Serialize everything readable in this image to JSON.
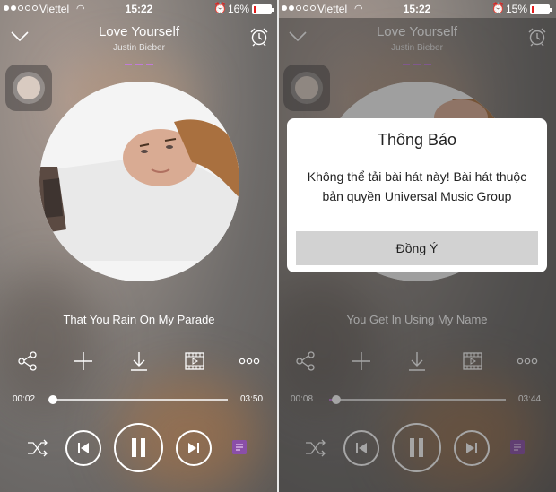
{
  "left": {
    "status": {
      "carrier": "Viettel",
      "time": "15:22",
      "battery": "16%",
      "battery_level": 0.16
    },
    "header": {
      "title": "Love Yourself",
      "artist": "Justin Bieber"
    },
    "now_playing": "That You Rain On My Parade",
    "player": {
      "elapsed": "00:02",
      "duration": "03:50",
      "progress": 0.01
    }
  },
  "right": {
    "status": {
      "carrier": "Viettel",
      "time": "15:22",
      "battery": "15%",
      "battery_level": 0.15
    },
    "header": {
      "title": "Love Yourself",
      "artist": "Justin Bieber"
    },
    "now_playing": "You Get In Using My Name",
    "player": {
      "elapsed": "00:08",
      "duration": "03:44",
      "progress": 0.04
    },
    "dialog": {
      "title": "Thông Báo",
      "message_line1": "Không thể tải bài hát này! Bài hát thuộc",
      "message_line2": "bản quyền Universal Music Group",
      "confirm_label": "Đồng Ý"
    }
  },
  "colors": {
    "accent": "#c07bd8",
    "battery_low": "#e31c1c",
    "dialog_button": "#d2d2d2"
  },
  "icons": [
    "chevron-down-icon",
    "alarm-clock-icon",
    "share-icon",
    "add-icon",
    "download-icon",
    "video-icon",
    "more-icon",
    "shuffle-icon",
    "previous-icon",
    "pause-icon",
    "next-icon",
    "playlist-icon"
  ]
}
